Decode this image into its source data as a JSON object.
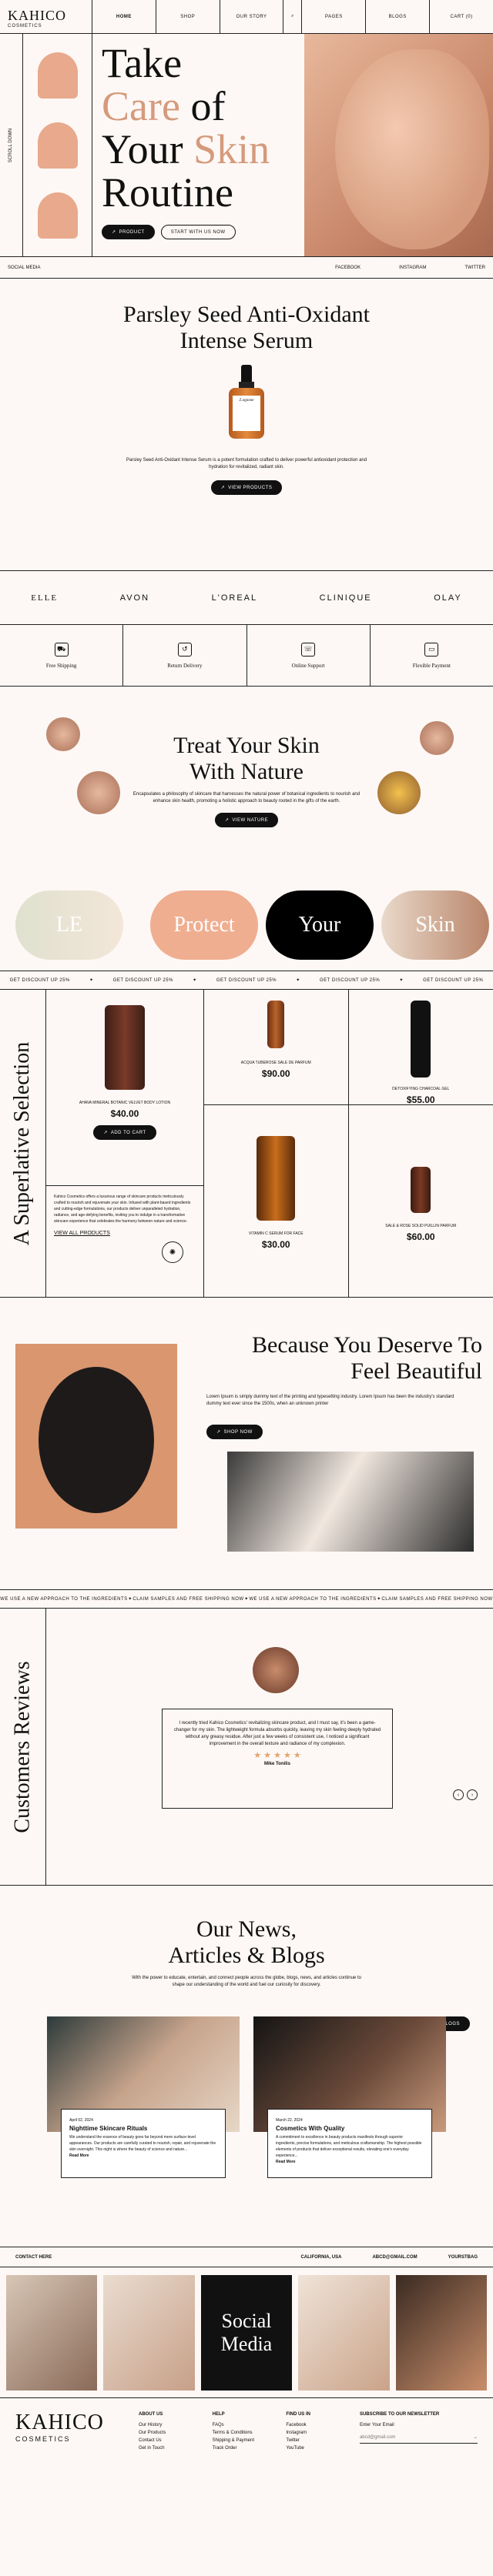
{
  "brand": {
    "name": "KAHICO",
    "sub": "COSMETICS"
  },
  "nav": [
    "HOME",
    "SHOP",
    "OUR STORY",
    "PAGES",
    "BLOGS",
    "CART (0)"
  ],
  "hero": {
    "line1": "Take",
    "line2a": "Care",
    "line2b": "of",
    "line3a": "Your",
    "line3b": "Skin",
    "line4": "Routine",
    "side_text": "SCROLL DOWN",
    "btn_product": "PRODUCT",
    "btn_start": "START WITH US NOW"
  },
  "social": {
    "left": "SOCIAL MEDIA",
    "links": [
      "FACEBOOK",
      "INSTAGRAM",
      "TWITTER"
    ]
  },
  "feature": {
    "title1": "Parsley Seed Anti-Oxidant",
    "title2": "Intense Serum",
    "bottle_label": "Z.ognone",
    "desc": "Parsley Seed Anti-Oxidant Intense Serum is a potent formulation crafted to deliver powerful antioxidant protection and hydration for revitalized, radiant skin.",
    "btn": "VIEW PRODUCTS"
  },
  "brands": [
    "ELLE",
    "AVON",
    "L'OREAL",
    "CLINIQUE",
    "OLAY"
  ],
  "services": [
    {
      "label": "Free Shipping",
      "icon": "truck-icon",
      "glyph": "⛟"
    },
    {
      "label": "Return Delivery",
      "icon": "return-icon",
      "glyph": "↺"
    },
    {
      "label": "Online Support",
      "icon": "support-icon",
      "glyph": "☏"
    },
    {
      "label": "Flexible Payment",
      "icon": "wallet-icon",
      "glyph": "▭"
    }
  ],
  "treat": {
    "title1": "Treat Your Skin",
    "title2": "With Nature",
    "desc": "Encapsulates a philosophy of skincare that harnesses the natural power of botanical ingredients to nourish and enhance skin health, promoting a holistic approach to beauty rooted in the gifts of the earth.",
    "btn": "VIEW NATURE"
  },
  "pills": [
    "LE",
    "Protect",
    "Your",
    "Skin"
  ],
  "ticker": [
    "GET DISCOUNT UP 25%",
    "GET DISCOUNT UP 25%",
    "GET DISCOUNT UP 25%",
    "GET DISCOUNT UP 25%",
    "GET DISCOUNT UP 25%"
  ],
  "superlative": {
    "title": "A Superlative Selection",
    "main_product": {
      "name": "AHAVA MINERAL BOTANIC VELVET BODY LOTION",
      "price": "$40.00",
      "btn": "ADD TO CART"
    },
    "about": "Kahico Cosmetics offers a luxurious range of skincare products meticulously crafted to nourish and rejuvenate your skin. Infused with plant-based ingredients and cutting-edge formulations, our products deliver unparalleled hydration, radiance, and age-defying benefits, inviting you to indulge in a transformative skincare experience that celebrates the harmony between nature and science.",
    "view_all": "VIEW ALL PRODUCTS",
    "grid": [
      {
        "name": "ACQUA TUBEROSE SALE DE PARFUM",
        "price": "$90.00"
      },
      {
        "name": "DETOXIFYING CHARCOAL GEL",
        "price": "$55.00"
      },
      {
        "name": "VITAMIN C SERUM FOR FACE",
        "price": "$30.00"
      },
      {
        "name": "SALE & ROSE SOLID PUILLIN PARFUM",
        "price": "$60.00"
      }
    ]
  },
  "because": {
    "title1": "Because You Deserve To",
    "title2": "Feel Beautiful",
    "desc": "Lorem Ipsum is simply dummy text of the printing and typesetting industry. Lorem Ipsum has been the industry's standard dummy text ever since the 1500s, when an unknown printer",
    "btn": "SHOP NOW"
  },
  "ticker2": [
    "WE USE A NEW APPROACH TO THE INGREDIENTS",
    "CLAIM SAMPLES AND FREE SHIPPING NOW",
    "WE USE A NEW APPROACH TO THE INGREDIENTS",
    "CLAIM SAMPLES AND FREE SHIPPING NOW"
  ],
  "reviews": {
    "title": "Customers Reviews",
    "text": "I recently tried Kahico Cosmetics' revitalizing skincare product, and I must say, it's been a game-changer for my skin. The lightweight formula absorbs quickly, leaving my skin feeling deeply hydrated without any greasy residue. After just a few weeks of consistent use, I noticed a significant improvement in the overall texture and radiance of my complexion.",
    "stars": "★ ★ ★ ★ ★",
    "author": "Mike Tonilis"
  },
  "news": {
    "title1": "Our News,",
    "title2": "Articles & Blogs",
    "intro": "With the power to educate, entertain, and connect people across the globe, blogs, news, and articles continue to shape our understanding of the world and fuel our curiosity for discovery.",
    "btn": "ALL BLOGS",
    "cards": [
      {
        "date": "April 02, 2024",
        "title": "Nighttime Skincare Rituals",
        "text": "We understand the essence of beauty goes far beyond mere surface-level appearances. Our products are carefully curated to nourish, repair, and rejuvenate the skin overnight. This night is where the beauty of science and nature...",
        "more": "Read More"
      },
      {
        "date": "March 22, 2024",
        "title": "Cosmetics With Quality",
        "text": "A commitment to excellence in beauty products manifests through superior ingredients, precise formulations, and meticulous craftsmanship. The highest possible elements of products that deliver exceptional results, elevating one's everyday experience...",
        "more": "Read More"
      }
    ]
  },
  "contact": {
    "left": "CONTACT HERE",
    "links": [
      "CALIFORNIA, USA",
      "ABCD@GMAIL.COM",
      "YOURSTBAG"
    ]
  },
  "gallery_text": "Social Media",
  "footer": {
    "brand": "KAHICO",
    "sub": "COSMETICS",
    "cols": [
      {
        "head": "ABOUT US",
        "items": [
          "Our History",
          "Our Products",
          "Contact Us",
          "Get in Touch"
        ]
      },
      {
        "head": "HELP",
        "items": [
          "FAQs",
          "Terms & Conditions",
          "Shipping & Payment",
          "Track Order"
        ]
      },
      {
        "head": "FIND US IN",
        "items": [
          "Facebook",
          "Instagram",
          "Twitter",
          "YouTube"
        ]
      }
    ],
    "newsletter_head": "SUBSCRIBE TO OUR NEWSLETTER",
    "newsletter_label": "Enter Your Email",
    "newsletter_placeholder": "abcd@gmail.com"
  }
}
